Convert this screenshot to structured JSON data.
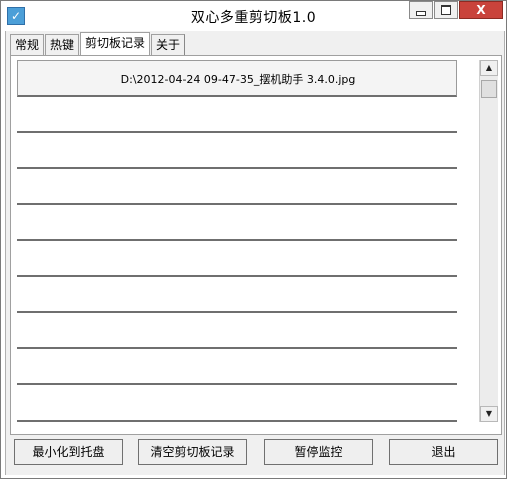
{
  "window": {
    "title": "双心多重剪切板1.0",
    "icon": "app-icon",
    "controls": {
      "minimize": "minimize-icon",
      "maximize": "maximize-icon",
      "close_label": "X"
    }
  },
  "tabs": [
    {
      "label": "常规",
      "active": false
    },
    {
      "label": "热键",
      "active": false
    },
    {
      "label": "剪切板记录",
      "active": true
    },
    {
      "label": "关于",
      "active": false
    }
  ],
  "history": {
    "items": [
      "D:\\2012-04-24 09-47-35_摆机助手 3.4.0.jpg",
      "",
      "",
      "",
      "",
      "",
      "",
      "",
      "",
      ""
    ]
  },
  "scrollbar": {
    "up_glyph": "▲",
    "down_glyph": "▼"
  },
  "buttons": {
    "minimize_tray": "最小化到托盘",
    "clear_history": "清空剪切板记录",
    "pause_monitor": "暂停监控",
    "exit": "退出"
  }
}
